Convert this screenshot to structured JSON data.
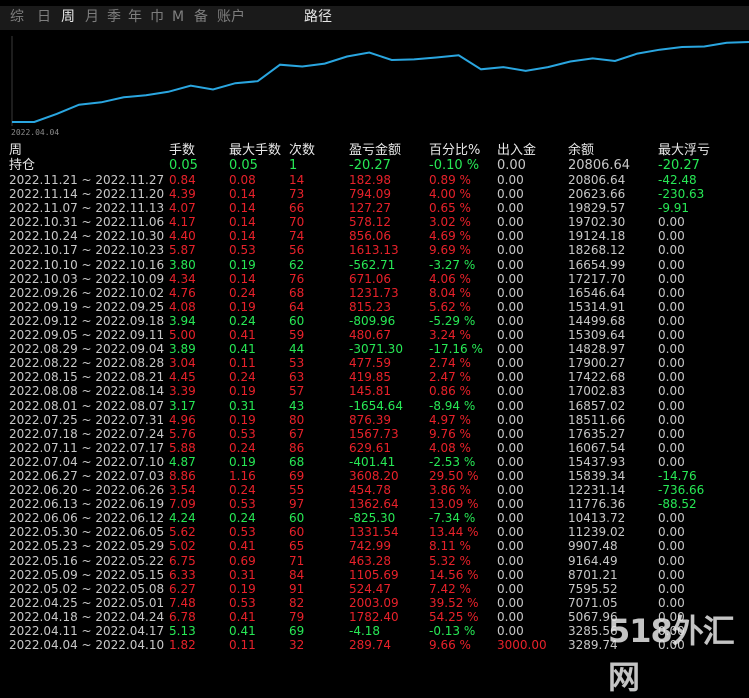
{
  "colors": {
    "background": "#000000",
    "line": "#2aa6e0",
    "positive": "#e8212a",
    "negative": "#27e855",
    "neutral": "#c8c8c8"
  },
  "tabs": [
    {
      "label": "综",
      "active": false
    },
    {
      "label": "日",
      "active": false
    },
    {
      "label": "周",
      "active": true
    },
    {
      "label": "月",
      "active": false
    },
    {
      "label": "季",
      "active": false
    },
    {
      "label": "年",
      "active": false
    },
    {
      "label": "巾",
      "active": false
    },
    {
      "label": "M",
      "active": false
    },
    {
      "label": "备",
      "active": false
    },
    {
      "label": "账户",
      "active": false
    },
    {
      "label": "路径",
      "active": false
    }
  ],
  "chart": {
    "start_date": "2022.04.04",
    "values": [
      3289.74,
      3285.56,
      5067.96,
      7071.05,
      7595.52,
      8701.21,
      9164.49,
      9907.48,
      11239.02,
      10413.72,
      11776.36,
      12231.14,
      15839.34,
      15437.93,
      16067.54,
      17635.27,
      18511.66,
      16857.02,
      17002.83,
      17422.68,
      17900.27,
      14828.97,
      15309.64,
      14499.68,
      15314.91,
      16546.64,
      17217.7,
      16654.99,
      18268.12,
      19124.18,
      19702.3,
      19829.57,
      20623.66,
      20806.64
    ]
  },
  "columns": [
    "手数",
    "最大手数",
    "次数",
    "盈亏金额",
    "百分比%",
    "出入金",
    "余额",
    "最大浮亏"
  ],
  "period_label": "周",
  "holding_row": {
    "label": "持仓",
    "lots": "0.05",
    "max_lots": "0.05",
    "count": "1",
    "pnl": "-20.27",
    "pct": "-0.10 %",
    "flow": "0.00",
    "balance": "20806.64",
    "max_float": "-20.27",
    "sign": "neg",
    "float_sign": "neg"
  },
  "rows": [
    {
      "date": "2022.11.21 ~ 2022.11.27",
      "lots": "0.84",
      "max_lots": "0.08",
      "count": "14",
      "pnl": "182.98",
      "pct": "0.89 %",
      "flow": "0.00",
      "balance": "20806.64",
      "max_float": "-42.48",
      "sign": "pos",
      "float_sign": "neg"
    },
    {
      "date": "2022.11.14 ~ 2022.11.20",
      "lots": "4.39",
      "max_lots": "0.14",
      "count": "73",
      "pnl": "794.09",
      "pct": "4.00 %",
      "flow": "0.00",
      "balance": "20623.66",
      "max_float": "-230.63",
      "sign": "pos",
      "float_sign": "neg"
    },
    {
      "date": "2022.11.07 ~ 2022.11.13",
      "lots": "4.07",
      "max_lots": "0.14",
      "count": "66",
      "pnl": "127.27",
      "pct": "0.65 %",
      "flow": "0.00",
      "balance": "19829.57",
      "max_float": "-9.91",
      "sign": "pos",
      "float_sign": "neg"
    },
    {
      "date": "2022.10.31 ~ 2022.11.06",
      "lots": "4.17",
      "max_lots": "0.14",
      "count": "70",
      "pnl": "578.12",
      "pct": "3.02 %",
      "flow": "0.00",
      "balance": "19702.30",
      "max_float": "0.00",
      "sign": "pos",
      "float_sign": "neutral"
    },
    {
      "date": "2022.10.24 ~ 2022.10.30",
      "lots": "4.40",
      "max_lots": "0.14",
      "count": "74",
      "pnl": "856.06",
      "pct": "4.69 %",
      "flow": "0.00",
      "balance": "19124.18",
      "max_float": "0.00",
      "sign": "pos",
      "float_sign": "neutral"
    },
    {
      "date": "2022.10.17 ~ 2022.10.23",
      "lots": "5.87",
      "max_lots": "0.53",
      "count": "56",
      "pnl": "1613.13",
      "pct": "9.69 %",
      "flow": "0.00",
      "balance": "18268.12",
      "max_float": "0.00",
      "sign": "pos",
      "float_sign": "neutral"
    },
    {
      "date": "2022.10.10 ~ 2022.10.16",
      "lots": "3.80",
      "max_lots": "0.19",
      "count": "62",
      "pnl": "-562.71",
      "pct": "-3.27 %",
      "flow": "0.00",
      "balance": "16654.99",
      "max_float": "0.00",
      "sign": "neg",
      "float_sign": "neutral"
    },
    {
      "date": "2022.10.03 ~ 2022.10.09",
      "lots": "4.34",
      "max_lots": "0.14",
      "count": "76",
      "pnl": "671.06",
      "pct": "4.06 %",
      "flow": "0.00",
      "balance": "17217.70",
      "max_float": "0.00",
      "sign": "pos",
      "float_sign": "neutral"
    },
    {
      "date": "2022.09.26 ~ 2022.10.02",
      "lots": "4.76",
      "max_lots": "0.24",
      "count": "68",
      "pnl": "1231.73",
      "pct": "8.04 %",
      "flow": "0.00",
      "balance": "16546.64",
      "max_float": "0.00",
      "sign": "pos",
      "float_sign": "neutral"
    },
    {
      "date": "2022.09.19 ~ 2022.09.25",
      "lots": "4.08",
      "max_lots": "0.19",
      "count": "64",
      "pnl": "815.23",
      "pct": "5.62 %",
      "flow": "0.00",
      "balance": "15314.91",
      "max_float": "0.00",
      "sign": "pos",
      "float_sign": "neutral"
    },
    {
      "date": "2022.09.12 ~ 2022.09.18",
      "lots": "3.94",
      "max_lots": "0.24",
      "count": "60",
      "pnl": "-809.96",
      "pct": "-5.29 %",
      "flow": "0.00",
      "balance": "14499.68",
      "max_float": "0.00",
      "sign": "neg",
      "float_sign": "neutral"
    },
    {
      "date": "2022.09.05 ~ 2022.09.11",
      "lots": "5.00",
      "max_lots": "0.41",
      "count": "59",
      "pnl": "480.67",
      "pct": "3.24 %",
      "flow": "0.00",
      "balance": "15309.64",
      "max_float": "0.00",
      "sign": "pos",
      "float_sign": "neutral"
    },
    {
      "date": "2022.08.29 ~ 2022.09.04",
      "lots": "3.89",
      "max_lots": "0.41",
      "count": "44",
      "pnl": "-3071.30",
      "pct": "-17.16 %",
      "flow": "0.00",
      "balance": "14828.97",
      "max_float": "0.00",
      "sign": "neg",
      "float_sign": "neutral"
    },
    {
      "date": "2022.08.22 ~ 2022.08.28",
      "lots": "3.04",
      "max_lots": "0.11",
      "count": "53",
      "pnl": "477.59",
      "pct": "2.74 %",
      "flow": "0.00",
      "balance": "17900.27",
      "max_float": "0.00",
      "sign": "pos",
      "float_sign": "neutral"
    },
    {
      "date": "2022.08.15 ~ 2022.08.21",
      "lots": "4.45",
      "max_lots": "0.24",
      "count": "63",
      "pnl": "419.85",
      "pct": "2.47 %",
      "flow": "0.00",
      "balance": "17422.68",
      "max_float": "0.00",
      "sign": "pos",
      "float_sign": "neutral"
    },
    {
      "date": "2022.08.08 ~ 2022.08.14",
      "lots": "3.39",
      "max_lots": "0.19",
      "count": "57",
      "pnl": "145.81",
      "pct": "0.86 %",
      "flow": "0.00",
      "balance": "17002.83",
      "max_float": "0.00",
      "sign": "pos",
      "float_sign": "neutral"
    },
    {
      "date": "2022.08.01 ~ 2022.08.07",
      "lots": "3.17",
      "max_lots": "0.31",
      "count": "43",
      "pnl": "-1654.64",
      "pct": "-8.94 %",
      "flow": "0.00",
      "balance": "16857.02",
      "max_float": "0.00",
      "sign": "neg",
      "float_sign": "neutral"
    },
    {
      "date": "2022.07.25 ~ 2022.07.31",
      "lots": "4.96",
      "max_lots": "0.19",
      "count": "80",
      "pnl": "876.39",
      "pct": "4.97 %",
      "flow": "0.00",
      "balance": "18511.66",
      "max_float": "0.00",
      "sign": "pos",
      "float_sign": "neutral"
    },
    {
      "date": "2022.07.18 ~ 2022.07.24",
      "lots": "5.76",
      "max_lots": "0.53",
      "count": "67",
      "pnl": "1567.73",
      "pct": "9.76 %",
      "flow": "0.00",
      "balance": "17635.27",
      "max_float": "0.00",
      "sign": "pos",
      "float_sign": "neutral"
    },
    {
      "date": "2022.07.11 ~ 2022.07.17",
      "lots": "5.88",
      "max_lots": "0.24",
      "count": "86",
      "pnl": "629.61",
      "pct": "4.08 %",
      "flow": "0.00",
      "balance": "16067.54",
      "max_float": "0.00",
      "sign": "pos",
      "float_sign": "neutral"
    },
    {
      "date": "2022.07.04 ~ 2022.07.10",
      "lots": "4.87",
      "max_lots": "0.19",
      "count": "68",
      "pnl": "-401.41",
      "pct": "-2.53 %",
      "flow": "0.00",
      "balance": "15437.93",
      "max_float": "0.00",
      "sign": "neg",
      "float_sign": "neutral"
    },
    {
      "date": "2022.06.27 ~ 2022.07.03",
      "lots": "8.86",
      "max_lots": "1.16",
      "count": "69",
      "pnl": "3608.20",
      "pct": "29.50 %",
      "flow": "0.00",
      "balance": "15839.34",
      "max_float": "-14.76",
      "sign": "pos",
      "float_sign": "neg"
    },
    {
      "date": "2022.06.20 ~ 2022.06.26",
      "lots": "3.54",
      "max_lots": "0.24",
      "count": "55",
      "pnl": "454.78",
      "pct": "3.86 %",
      "flow": "0.00",
      "balance": "12231.14",
      "max_float": "-736.66",
      "sign": "pos",
      "float_sign": "neg"
    },
    {
      "date": "2022.06.13 ~ 2022.06.19",
      "lots": "7.09",
      "max_lots": "0.53",
      "count": "97",
      "pnl": "1362.64",
      "pct": "13.09 %",
      "flow": "0.00",
      "balance": "11776.36",
      "max_float": "-88.52",
      "sign": "pos",
      "float_sign": "neg"
    },
    {
      "date": "2022.06.06 ~ 2022.06.12",
      "lots": "4.24",
      "max_lots": "0.24",
      "count": "60",
      "pnl": "-825.30",
      "pct": "-7.34 %",
      "flow": "0.00",
      "balance": "10413.72",
      "max_float": "0.00",
      "sign": "neg",
      "float_sign": "neutral"
    },
    {
      "date": "2022.05.30 ~ 2022.06.05",
      "lots": "5.62",
      "max_lots": "0.53",
      "count": "60",
      "pnl": "1331.54",
      "pct": "13.44 %",
      "flow": "0.00",
      "balance": "11239.02",
      "max_float": "0.00",
      "sign": "pos",
      "float_sign": "neutral"
    },
    {
      "date": "2022.05.23 ~ 2022.05.29",
      "lots": "5.02",
      "max_lots": "0.41",
      "count": "65",
      "pnl": "742.99",
      "pct": "8.11 %",
      "flow": "0.00",
      "balance": "9907.48",
      "max_float": "0.00",
      "sign": "pos",
      "float_sign": "neutral"
    },
    {
      "date": "2022.05.16 ~ 2022.05.22",
      "lots": "6.75",
      "max_lots": "0.69",
      "count": "71",
      "pnl": "463.28",
      "pct": "5.32 %",
      "flow": "0.00",
      "balance": "9164.49",
      "max_float": "0.00",
      "sign": "pos",
      "float_sign": "neutral"
    },
    {
      "date": "2022.05.09 ~ 2022.05.15",
      "lots": "6.33",
      "max_lots": "0.31",
      "count": "84",
      "pnl": "1105.69",
      "pct": "14.56 %",
      "flow": "0.00",
      "balance": "8701.21",
      "max_float": "0.00",
      "sign": "pos",
      "float_sign": "neutral"
    },
    {
      "date": "2022.05.02 ~ 2022.05.08",
      "lots": "6.27",
      "max_lots": "0.19",
      "count": "91",
      "pnl": "524.47",
      "pct": "7.42 %",
      "flow": "0.00",
      "balance": "7595.52",
      "max_float": "0.00",
      "sign": "pos",
      "float_sign": "neutral"
    },
    {
      "date": "2022.04.25 ~ 2022.05.01",
      "lots": "7.48",
      "max_lots": "0.53",
      "count": "82",
      "pnl": "2003.09",
      "pct": "39.52 %",
      "flow": "0.00",
      "balance": "7071.05",
      "max_float": "0.00",
      "sign": "pos",
      "float_sign": "neutral"
    },
    {
      "date": "2022.04.18 ~ 2022.04.24",
      "lots": "6.78",
      "max_lots": "0.41",
      "count": "79",
      "pnl": "1782.40",
      "pct": "54.25 %",
      "flow": "0.00",
      "balance": "5067.96",
      "max_float": "0.00",
      "sign": "pos",
      "float_sign": "neutral"
    },
    {
      "date": "2022.04.11 ~ 2022.04.17",
      "lots": "5.13",
      "max_lots": "0.41",
      "count": "69",
      "pnl": "-4.18",
      "pct": "-0.13 %",
      "flow": "0.00",
      "balance": "3285.56",
      "max_float": "0.00",
      "sign": "neg",
      "float_sign": "neutral"
    },
    {
      "date": "2022.04.04 ~ 2022.04.10",
      "lots": "1.82",
      "max_lots": "0.11",
      "count": "32",
      "pnl": "289.74",
      "pct": "9.66 %",
      "flow": "3000.00",
      "balance": "3289.74",
      "max_float": "0.00",
      "sign": "pos",
      "float_sign": "neutral",
      "flow_sign": "pos"
    }
  ],
  "watermark": "518外汇网"
}
